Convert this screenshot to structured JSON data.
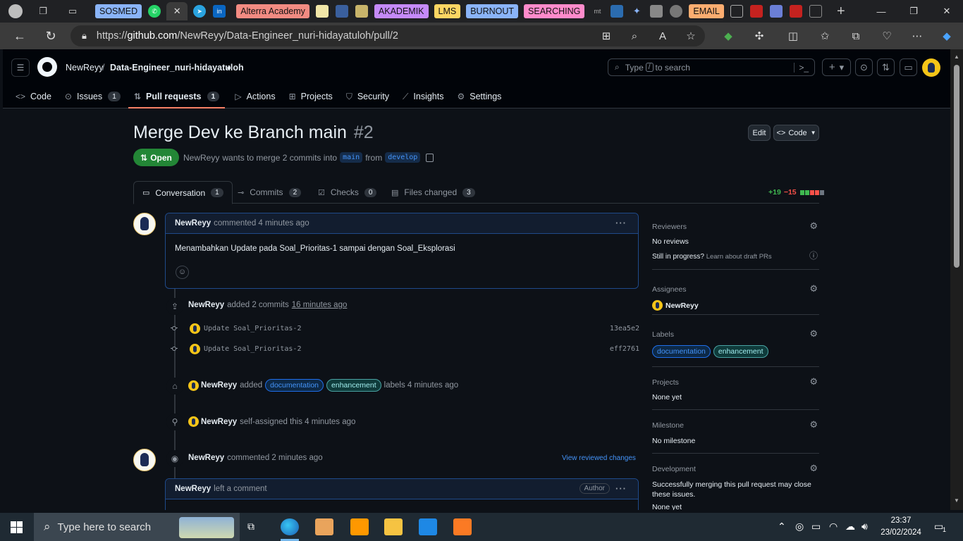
{
  "browser": {
    "tab_groups": [
      {
        "label": "SOSMED",
        "color": "#8ab4f8"
      },
      {
        "label": "Alterra Academy",
        "color": "#f28b82"
      },
      {
        "label": "AKADEMIK",
        "color": "#c58af9"
      },
      {
        "label": "LMS",
        "color": "#fdd663"
      },
      {
        "label": "BURNOUT",
        "color": "#8ab4f8"
      },
      {
        "label": "SEARCHING",
        "color": "#ff8bcb"
      },
      {
        "label": "EMAIL",
        "color": "#fcad70"
      }
    ],
    "url_prefix": "https://",
    "url_host": "github.com",
    "url_path": "/NewReyy/Data-Engineer_nuri-hidayatuloh/pull/2"
  },
  "header": {
    "owner": "NewReyy",
    "separator": "/",
    "repo": "Data-Engineer_nuri-hidayatuloh",
    "search_text": "Type",
    "search_key": "/",
    "search_suffix": "to search",
    "plus": "+"
  },
  "repo_nav": [
    {
      "label": "Code",
      "icon": "<>",
      "count": ""
    },
    {
      "label": "Issues",
      "icon": "⊙",
      "count": "1"
    },
    {
      "label": "Pull requests",
      "icon": "⇅",
      "count": "1"
    },
    {
      "label": "Actions",
      "icon": "▷",
      "count": ""
    },
    {
      "label": "Projects",
      "icon": "⊞",
      "count": ""
    },
    {
      "label": "Security",
      "icon": "⛉",
      "count": ""
    },
    {
      "label": "Insights",
      "icon": "⟋",
      "count": ""
    },
    {
      "label": "Settings",
      "icon": "⚙",
      "count": ""
    }
  ],
  "pr": {
    "title": "Merge Dev ke Branch main",
    "number": "#2",
    "edit_label": "Edit",
    "code_label": "Code",
    "state": "Open",
    "author": "NewReyy",
    "merge_text": "wants to merge 2 commits into",
    "base": "main",
    "from_text": "from",
    "head": "develop"
  },
  "pr_tabs": [
    {
      "label": "Conversation",
      "count": "1"
    },
    {
      "label": "Commits",
      "count": "2"
    },
    {
      "label": "Checks",
      "count": "0"
    },
    {
      "label": "Files changed",
      "count": "3"
    }
  ],
  "diffstat": {
    "additions": "+19",
    "deletions": "−15"
  },
  "comment1": {
    "author": "NewReyy",
    "meta": "commented 4 minutes ago",
    "body": "Menambahkan Update pada Soal_Prioritas-1 sampai dengan Soal_Eksplorasi"
  },
  "commits_event": {
    "author": "NewReyy",
    "text": "added 2 commits",
    "time": "16 minutes ago",
    "commits": [
      {
        "message": "Update Soal_Prioritas-2",
        "sha": "13ea5e2"
      },
      {
        "message": "Update Soal_Prioritas-2",
        "sha": "eff2761"
      }
    ]
  },
  "labels_event": {
    "author": "NewReyy",
    "verb": "added",
    "labels": [
      "documentation",
      "enhancement"
    ],
    "suffix": "labels 4 minutes ago"
  },
  "assign_event": {
    "author": "NewReyy",
    "text": "self-assigned this 4 minutes ago"
  },
  "review_event": {
    "author": "NewReyy",
    "text": "commented 2 minutes ago",
    "link": "View reviewed changes"
  },
  "comment2": {
    "author": "NewReyy",
    "meta": "left a comment",
    "badge": "Author"
  },
  "sidebar": {
    "reviewers_title": "Reviewers",
    "reviewers_value": "No reviews",
    "progress_q": "Still in progress?",
    "progress_link": "Learn about draft PRs",
    "assignees_title": "Assignees",
    "assignee": "NewReyy",
    "labels_title": "Labels",
    "labels": [
      "documentation",
      "enhancement"
    ],
    "projects_title": "Projects",
    "projects_value": "None yet",
    "milestone_title": "Milestone",
    "milestone_value": "No milestone",
    "development_title": "Development",
    "development_value": "Successfully merging this pull request may close these issues.",
    "development_more": "None yet"
  },
  "taskbar": {
    "search_placeholder": "Type here to search",
    "time": "23:37",
    "date": "23/02/2024",
    "notifications": "1"
  }
}
